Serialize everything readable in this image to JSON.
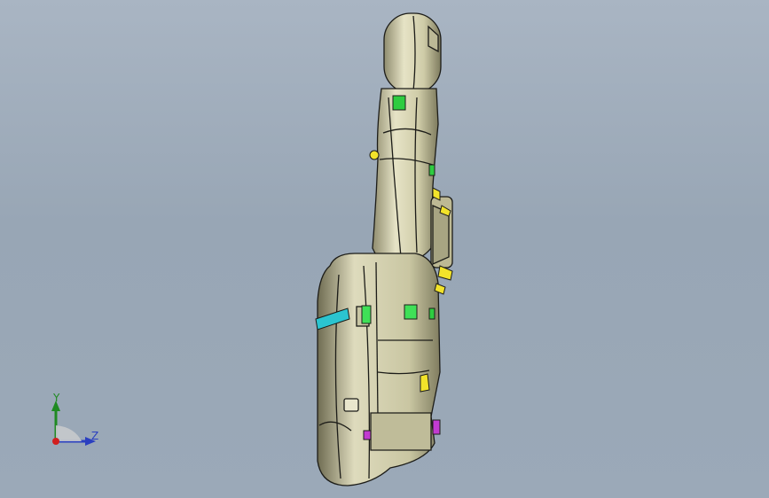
{
  "viewport": {
    "background_top": "#a9b5c3",
    "background_bottom": "#9ba9b8"
  },
  "model": {
    "body_color": "#d9d6b4",
    "edge_color": "#1c1c18",
    "accent_green": "#2ecc40",
    "accent_yellow": "#f2e32a",
    "accent_cyan": "#2bc4d0",
    "accent_magenta": "#c23bd1"
  },
  "triad": {
    "y_label": "Y",
    "z_label": "Z",
    "y_color": "#1f8a22",
    "z_color": "#2a3fc0",
    "origin_color": "#d11f1f"
  }
}
